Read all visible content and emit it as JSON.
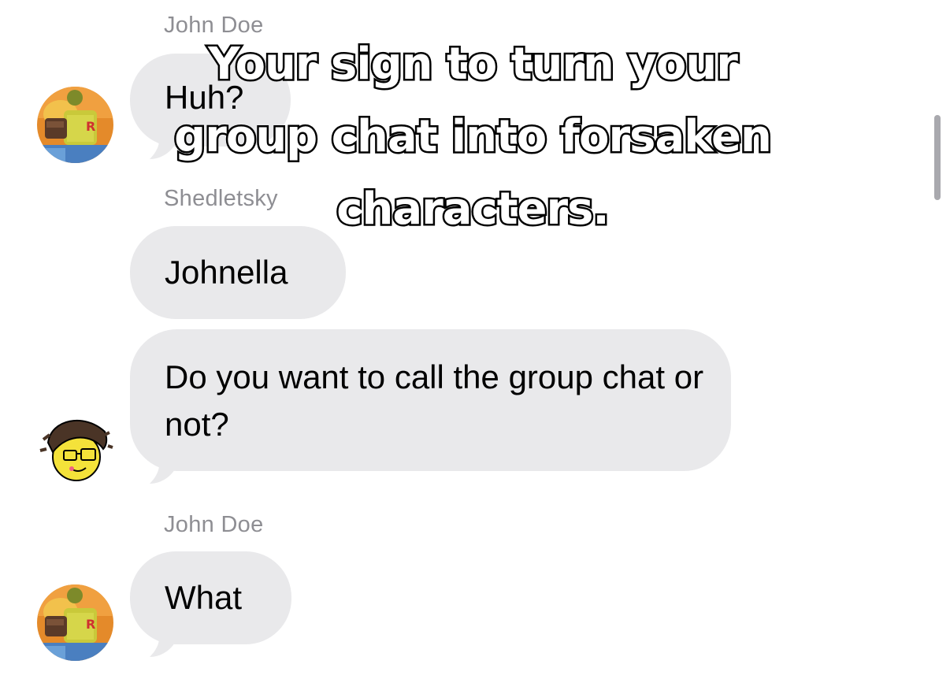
{
  "overlay": {
    "lines": [
      "Your sign to turn your",
      "group chat into forsaken",
      "characters."
    ]
  },
  "messages": [
    {
      "sender": "John Doe",
      "text": "Huh?",
      "avatar": "john-doe-avatar"
    },
    {
      "sender": "Shedletsky",
      "text": "Johnella",
      "avatar": ""
    },
    {
      "sender": "",
      "text": "Do you want to call the group chat or not?",
      "avatar": "shedletsky-avatar"
    },
    {
      "sender": "John Doe",
      "text": "What",
      "avatar": "john-doe-avatar"
    }
  ],
  "colors": {
    "bubble": "#e9e9eb",
    "sender_text": "#8e8e93",
    "message_text": "#000000",
    "overlay_fill": "#ffffff",
    "overlay_stroke": "#000000"
  }
}
